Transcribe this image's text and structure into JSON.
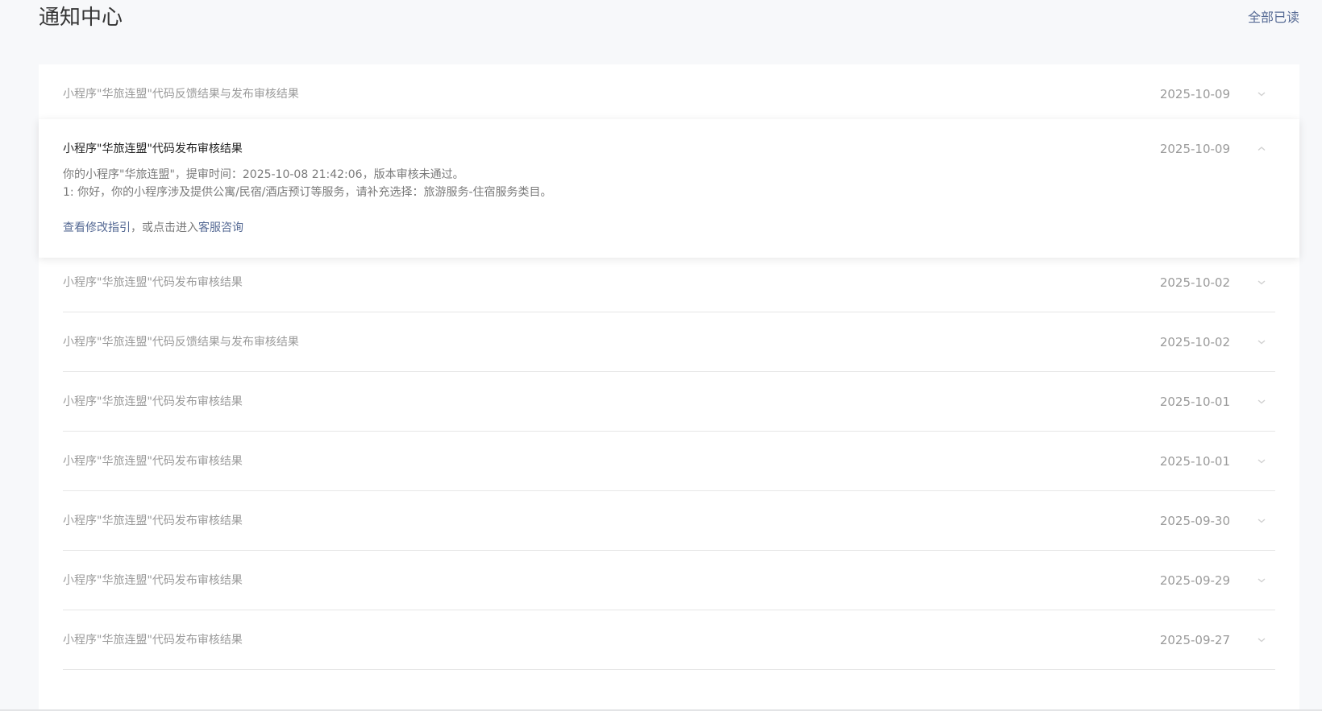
{
  "header": {
    "title": "通知中心",
    "mark_all_read": "全部已读"
  },
  "notifications": [
    {
      "title": "小程序\"华旅连盟\"代码反馈结果与发布审核结果",
      "date": "2025-10-09",
      "expanded": false
    },
    {
      "title": "小程序\"华旅连盟\"代码发布审核结果",
      "date": "2025-10-09",
      "expanded": true
    },
    {
      "title": "小程序\"华旅连盟\"代码发布审核结果",
      "date": "2025-10-02",
      "expanded": false
    },
    {
      "title": "小程序\"华旅连盟\"代码反馈结果与发布审核结果",
      "date": "2025-10-02",
      "expanded": false
    },
    {
      "title": "小程序\"华旅连盟\"代码发布审核结果",
      "date": "2025-10-01",
      "expanded": false
    },
    {
      "title": "小程序\"华旅连盟\"代码发布审核结果",
      "date": "2025-10-01",
      "expanded": false
    },
    {
      "title": "小程序\"华旅连盟\"代码发布审核结果",
      "date": "2025-09-30",
      "expanded": false
    },
    {
      "title": "小程序\"华旅连盟\"代码发布审核结果",
      "date": "2025-09-29",
      "expanded": false
    },
    {
      "title": "小程序\"华旅连盟\"代码发布审核结果",
      "date": "2025-09-27",
      "expanded": false
    }
  ],
  "expanded_detail": {
    "line1": "你的小程序\"华旅连盟\"，提审时间：2025-10-08 21:42:06，版本审核未通过。",
    "line2": "1: 你好，你的小程序涉及提供公寓/民宿/酒店预订等服务，请补充选择：旅游服务-住宿服务类目。",
    "guide_link": "查看修改指引",
    "middle_text": "，或点击进入",
    "support_link": "客服咨询"
  },
  "icons": {
    "collapsed": "chevron-down-icon",
    "expanded": "chevron-up-icon"
  },
  "colors": {
    "link": "#576b95",
    "muted_text": "#9a9a9a",
    "active_title": "#222222",
    "background": "#f7f8fa"
  }
}
